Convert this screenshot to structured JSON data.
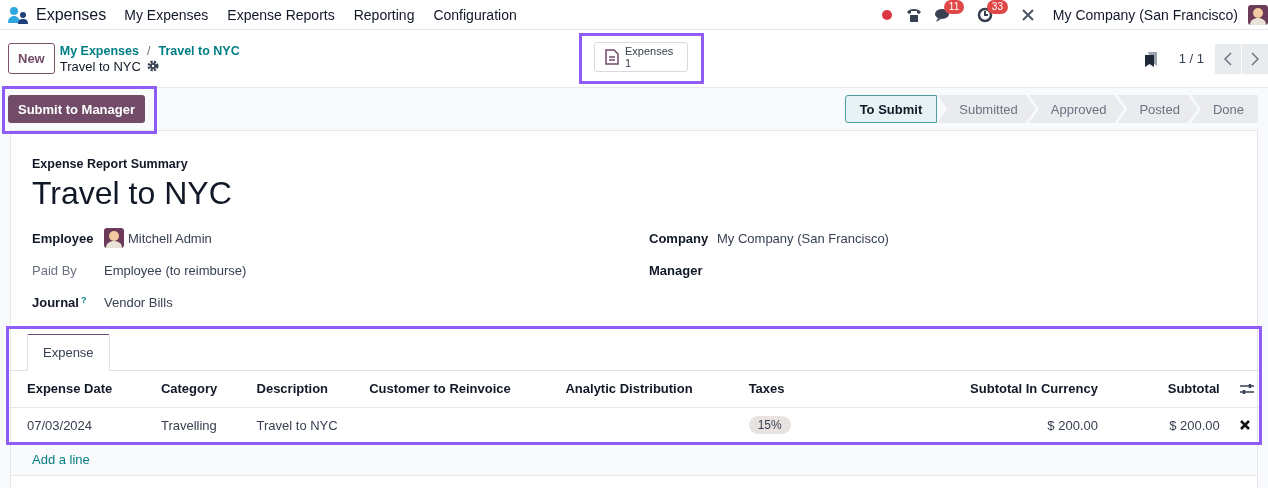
{
  "navbar": {
    "app_name": "Expenses",
    "menu": [
      "My Expenses",
      "Expense Reports",
      "Reporting",
      "Configuration"
    ],
    "messages_count": "11",
    "activities_count": "33",
    "company": "My Company (San Francisco)"
  },
  "control_panel": {
    "new_button": "New",
    "breadcrumbs": [
      "My Expenses",
      "Travel to NYC"
    ],
    "breadcrumb_separator": "/",
    "record_title": "Travel to NYC",
    "smart_button": {
      "label": "Expenses",
      "count": "1",
      "highlighted": true
    },
    "pager": "1 / 1"
  },
  "action_buttons": [
    {
      "label": "Submit to Manager",
      "highlighted": true
    }
  ],
  "statusbar": [
    {
      "label": "To Submit",
      "selected": true
    },
    {
      "label": "Submitted",
      "selected": false
    },
    {
      "label": "Approved",
      "selected": false
    },
    {
      "label": "Posted",
      "selected": false
    },
    {
      "label": "Done",
      "selected": false
    }
  ],
  "sheet": {
    "subtitle": "Expense Report Summary",
    "title": "Travel to NYC",
    "left_fields": [
      {
        "label": "Employee",
        "bold": true,
        "kind": "avatar",
        "value": "Mitchell Admin"
      },
      {
        "label": "Paid By",
        "bold": false,
        "kind": "text",
        "value": "Employee (to reimburse)"
      },
      {
        "label": "Journal",
        "bold": true,
        "kind": "text",
        "help": "?",
        "value": "Vendor Bills"
      }
    ],
    "right_fields": [
      {
        "label": "Company",
        "bold": true,
        "value": "My Company (San Francisco)"
      },
      {
        "label": "Manager",
        "bold": true
      }
    ]
  },
  "notebook": {
    "highlighted": true,
    "tabs": [
      {
        "label": "Expense",
        "selected": true
      }
    ],
    "table": {
      "columns": [
        {
          "label": "Expense Date",
          "kind": "text"
        },
        {
          "label": "Category",
          "kind": "text"
        },
        {
          "label": "Description",
          "kind": "text"
        },
        {
          "label": "Customer to Reinvoice",
          "kind": "text"
        },
        {
          "label": "Analytic Distribution",
          "kind": "text"
        },
        {
          "label": "Taxes",
          "kind": "tags"
        },
        {
          "label": "Subtotal In Currency",
          "kind": "amount"
        },
        {
          "label": "Subtotal",
          "kind": "amount"
        }
      ],
      "rows": [
        {
          "cells": [
            {
              "text": "07/03/2024"
            },
            {
              "text": "Travelling"
            },
            {
              "text": "Travel to NYC"
            },
            {},
            {},
            {
              "tags": [
                "15%"
              ]
            },
            {
              "text": "$ 200.00"
            },
            {
              "text": "$ 200.00"
            }
          ]
        }
      ],
      "add_line": "Add a line"
    }
  }
}
